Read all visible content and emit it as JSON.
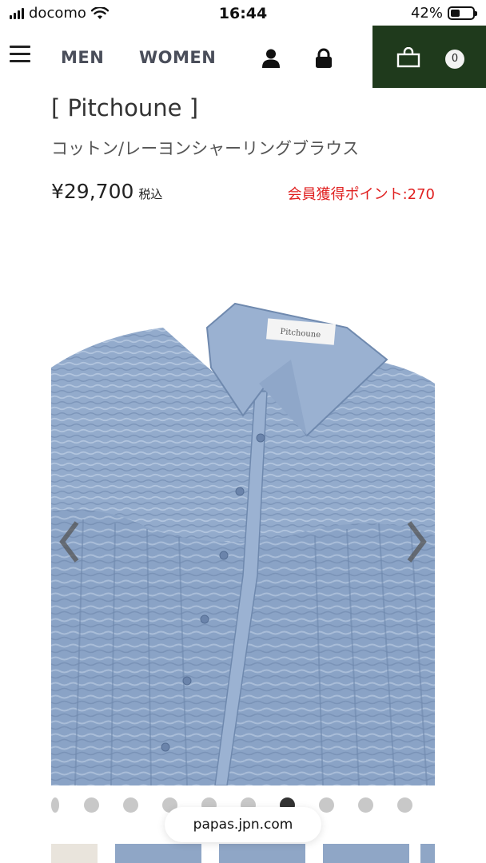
{
  "status_bar": {
    "carrier": "docomo",
    "time": "16:44",
    "battery_percent": "42%",
    "battery_level": 0.42,
    "icons": [
      "signal-icon",
      "wifi-icon",
      "battery-icon"
    ]
  },
  "nav": {
    "menu_icon": "hamburger-icon",
    "men_label": "MEN",
    "women_label": "WOMEN",
    "account_icon": "user-icon",
    "lock_icon": "lock-icon",
    "cart_icon": "shopping-bag-icon",
    "cart_count": "0",
    "cart_bg_color": "#1f3a1c"
  },
  "product": {
    "brand": "[ Pitchoune ]",
    "name": "コットン/レーヨンシャーリングブラウス",
    "price": "¥29,700",
    "tax_label": "税込",
    "points_label": "会員獲得ポイント:270",
    "points_color": "#e02020",
    "image_label": "Pitchoune",
    "image_alt_icon": "blouse-product-photo",
    "prev_icon": "chevron-left-icon",
    "next_icon": "chevron-right-icon"
  },
  "carousel": {
    "dot_count": 10,
    "active_index": 6
  },
  "browser": {
    "url": "papas.jpn.com"
  }
}
